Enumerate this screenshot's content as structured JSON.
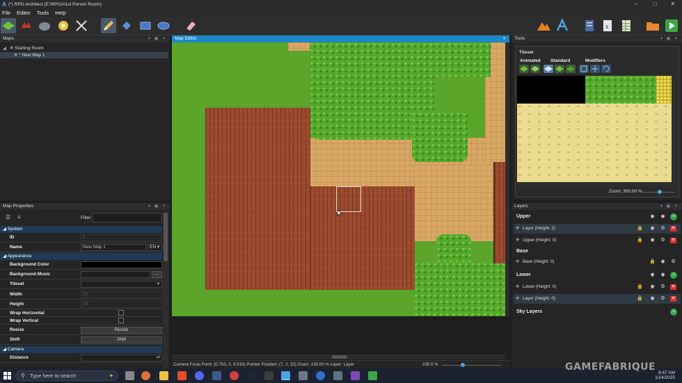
{
  "window": {
    "title": "(*) RPG Architect (E:\\RPGA\\1st Person Room)",
    "minimize": "–",
    "maximize": "□",
    "close": "✕"
  },
  "menu": [
    "File",
    "Editor",
    "Tools",
    "Help"
  ],
  "panels": {
    "maps": "Maps",
    "map_properties": "Map Properties",
    "map_editor": "Map Editor",
    "tools": "Tools",
    "tileset": "Tileset",
    "layers": "Layers"
  },
  "maps_tree": {
    "root": "Starting Room",
    "child": "New Map 1"
  },
  "properties": {
    "filter_label": "Filter",
    "sections": {
      "system": "System",
      "appearance": "Appearance",
      "camera": "Camera"
    },
    "rows": {
      "id": {
        "label": "ID",
        "value": "1"
      },
      "name": {
        "label": "Name",
        "value": "New Map 1",
        "lang": "EN"
      },
      "bgcolor": {
        "label": "Background Color"
      },
      "bgmusic": {
        "label": "Background Music",
        "button": "..."
      },
      "tileset": {
        "label": "Tileset"
      },
      "width": {
        "label": "Width",
        "value": "20"
      },
      "height": {
        "label": "Height",
        "value": "20"
      },
      "wraph": {
        "label": "Wrap Horizontal"
      },
      "wrapv": {
        "label": "Wrap Vertical"
      },
      "resize": {
        "label": "Resize",
        "button": "Resize"
      },
      "shift": {
        "label": "Shift",
        "button": "Shift"
      },
      "distance": {
        "label": "Distance"
      }
    }
  },
  "tileset": {
    "tabs": [
      "Animated",
      "Standard",
      "Modifiers"
    ],
    "zoom_label": "Zoom: 300.00 %",
    "zoom_fraction": 0.55
  },
  "layers": {
    "upper": {
      "label": "Upper",
      "rows": [
        "Layer (Height: 2)",
        "Upper (Height: 0)"
      ]
    },
    "base": {
      "label": "Base",
      "rows": [
        "Base (Height: 0)"
      ]
    },
    "lower": {
      "label": "Lower",
      "rows": [
        "Lower (Height: 0)",
        "Layer (Height: 0)"
      ]
    },
    "sky": {
      "label": "Sky Layers"
    }
  },
  "status": {
    "text": "Camera Focal Point: (0.703, 0, 9.519) Pointer Position: (7, 2, 15) Zoom: 230.00 % Layer: Layer",
    "zoom": "230.0 %",
    "zoom_fraction": 0.35
  },
  "taskbar": {
    "search_placeholder": "Type here to search",
    "time": "8:47 AM",
    "date": "1/14/2025"
  },
  "watermark": "GAMEFABRIQUE",
  "colors": {
    "accent": "#1c88c7",
    "delete": "#d9342b",
    "add": "#3aa648",
    "lock": "#e0b020"
  }
}
